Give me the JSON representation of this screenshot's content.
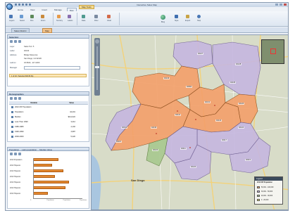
{
  "window": {
    "title": "Interactive Sales Map",
    "quick_access": [
      "save-icon",
      "undo-icon",
      "redo-icon",
      "print-icon",
      "dropdown-icon"
    ]
  },
  "ribbon_tabs": [
    {
      "label": "Home"
    },
    {
      "label": "View"
    },
    {
      "label": "Insert"
    },
    {
      "label": "Manage"
    },
    {
      "label": "Map"
    }
  ],
  "context_tab": {
    "label": "Map Tools"
  },
  "ribbon_groups": [
    {
      "buttons": [
        {
          "icon": "layers-icon",
          "label": "Layers"
        },
        {
          "icon": "select-icon",
          "label": "Select"
        },
        {
          "icon": "pan-icon",
          "label": "Pan"
        },
        {
          "icon": "zoom-icon",
          "label": "Zoom"
        }
      ]
    },
    {
      "buttons": [
        {
          "icon": "territory-icon",
          "label": "Territory"
        },
        {
          "icon": "label-icon",
          "label": "Labels"
        }
      ]
    },
    {
      "buttons": [
        {
          "icon": "data-icon",
          "label": "Data"
        },
        {
          "icon": "filter-icon",
          "label": "Filter"
        },
        {
          "icon": "chart-icon",
          "label": "Chart"
        }
      ]
    },
    {
      "buttons": [
        {
          "icon": "globe-icon",
          "label": "Bing"
        },
        {
          "icon": "style-icon",
          "label": "Style"
        },
        {
          "icon": "export-icon",
          "label": "Export"
        },
        {
          "icon": "help-icon",
          "label": "Help"
        }
      ]
    }
  ],
  "doc_tabs": [
    {
      "label": "Sales District"
    },
    {
      "label": "Map"
    }
  ],
  "selection_panel": {
    "title": "Selection",
    "fields": [
      {
        "key": "Layer",
        "value": "Sales Terr. 5"
      },
      {
        "key": "Label",
        "value": "92130"
      },
      {
        "key": "Address",
        "value": "Bridge Mesa Ave"
      },
      {
        "key": "",
        "value": "San Diego, CA 92130"
      },
      {
        "key": "Lat/Lon",
        "value": "32.9520, -117.2200"
      },
      {
        "key": "Manager",
        "value": ""
      }
    ],
    "highlight": "1 of 24 / Selected 92130 Zip"
  },
  "demographics_panel": {
    "title": "Demographics",
    "columns": [
      "Variable",
      "Value"
    ],
    "rows": [
      {
        "label": "2010 ZIP Population",
        "value": ""
      },
      {
        "label": "Population",
        "value": "44,201"
      },
      {
        "label": "Median",
        "value": "$111,622"
      },
      {
        "label": "Less Than 1999",
        "value": "3,212"
      },
      {
        "label": "1980-1989",
        "value": "4,102"
      },
      {
        "label": "1990-1999",
        "value": "4,987"
      },
      {
        "label": "2000-2009",
        "value": "5,220"
      }
    ]
  },
  "chart_panel": {
    "tabs": [
      "Population",
      "Latin population",
      "Median Value"
    ],
    "chart_data": {
      "type": "bar",
      "categories": [
        "2010 Population",
        "2010 Hispanic",
        "2010 Hispanic",
        "2010 Hispanic",
        "2010 Hispanic",
        "2010 Hispanic",
        "2010 Hispanic"
      ],
      "values": [
        52,
        38,
        61,
        44,
        73,
        66,
        30
      ],
      "xlabel": "",
      "ylabel": "",
      "xlim": [
        0,
        100
      ],
      "xticks": [
        "0",
        "Population",
        "Population",
        "Population"
      ]
    }
  },
  "map": {
    "city_label": "San Diego",
    "zip_labels": [
      "92129",
      "92127",
      "92128",
      "92064",
      "92131",
      "92126",
      "92121",
      "92130",
      "92014",
      "92122",
      "92117",
      "92111",
      "92123",
      "92124",
      "92119",
      "92120",
      "92115",
      "92105"
    ],
    "legend": {
      "title": "Legend",
      "subtitle": "2010 ZIP Population",
      "rows": [
        {
          "label": "50,001 - 100,000",
          "color": "#f4a06a"
        },
        {
          "label": "30,001 - 50,000",
          "color": "#c6b7e0"
        },
        {
          "label": "20,001 - 30,000",
          "color": "#a8c98f"
        },
        {
          "label": "0 - 20,000",
          "color": "#f1ef6a"
        }
      ]
    }
  }
}
